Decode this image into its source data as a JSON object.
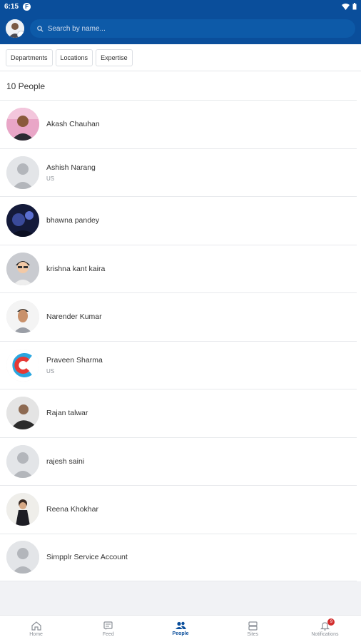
{
  "status": {
    "time": "6:15",
    "app_badge": "F"
  },
  "header": {
    "search_placeholder": "Search by name..."
  },
  "filters": [
    "Departments",
    "Locations",
    "Expertise"
  ],
  "count_label": "10 People",
  "people": [
    {
      "name": "Akash Chauhan",
      "location": "",
      "avatar": "photo-pink"
    },
    {
      "name": "Ashish Narang",
      "location": "US",
      "avatar": "default"
    },
    {
      "name": "bhawna pandey",
      "location": "",
      "avatar": "photo-dark-blue"
    },
    {
      "name": "krishna kant kaira",
      "location": "",
      "avatar": "photo-cartoon"
    },
    {
      "name": "Narender Kumar",
      "location": "",
      "avatar": "photo-portrait"
    },
    {
      "name": "Praveen Sharma",
      "location": "US",
      "avatar": "logo-c"
    },
    {
      "name": "Rajan talwar",
      "location": "",
      "avatar": "photo-gray"
    },
    {
      "name": "rajesh saini",
      "location": "",
      "avatar": "default"
    },
    {
      "name": "Reena Khokhar",
      "location": "",
      "avatar": "photo-light"
    },
    {
      "name": "Simpplr Service Account",
      "location": "",
      "avatar": "default"
    }
  ],
  "nav": [
    {
      "label": "Home",
      "icon": "home-icon",
      "active": false
    },
    {
      "label": "Feed",
      "icon": "feed-icon",
      "active": false
    },
    {
      "label": "People",
      "icon": "people-icon",
      "active": true
    },
    {
      "label": "Sites",
      "icon": "sites-icon",
      "active": false
    },
    {
      "label": "Notifications",
      "icon": "bell-icon",
      "active": false,
      "badge": "9"
    }
  ],
  "colors": {
    "brand": "#0a4e9b",
    "badge": "#d32f2f"
  }
}
